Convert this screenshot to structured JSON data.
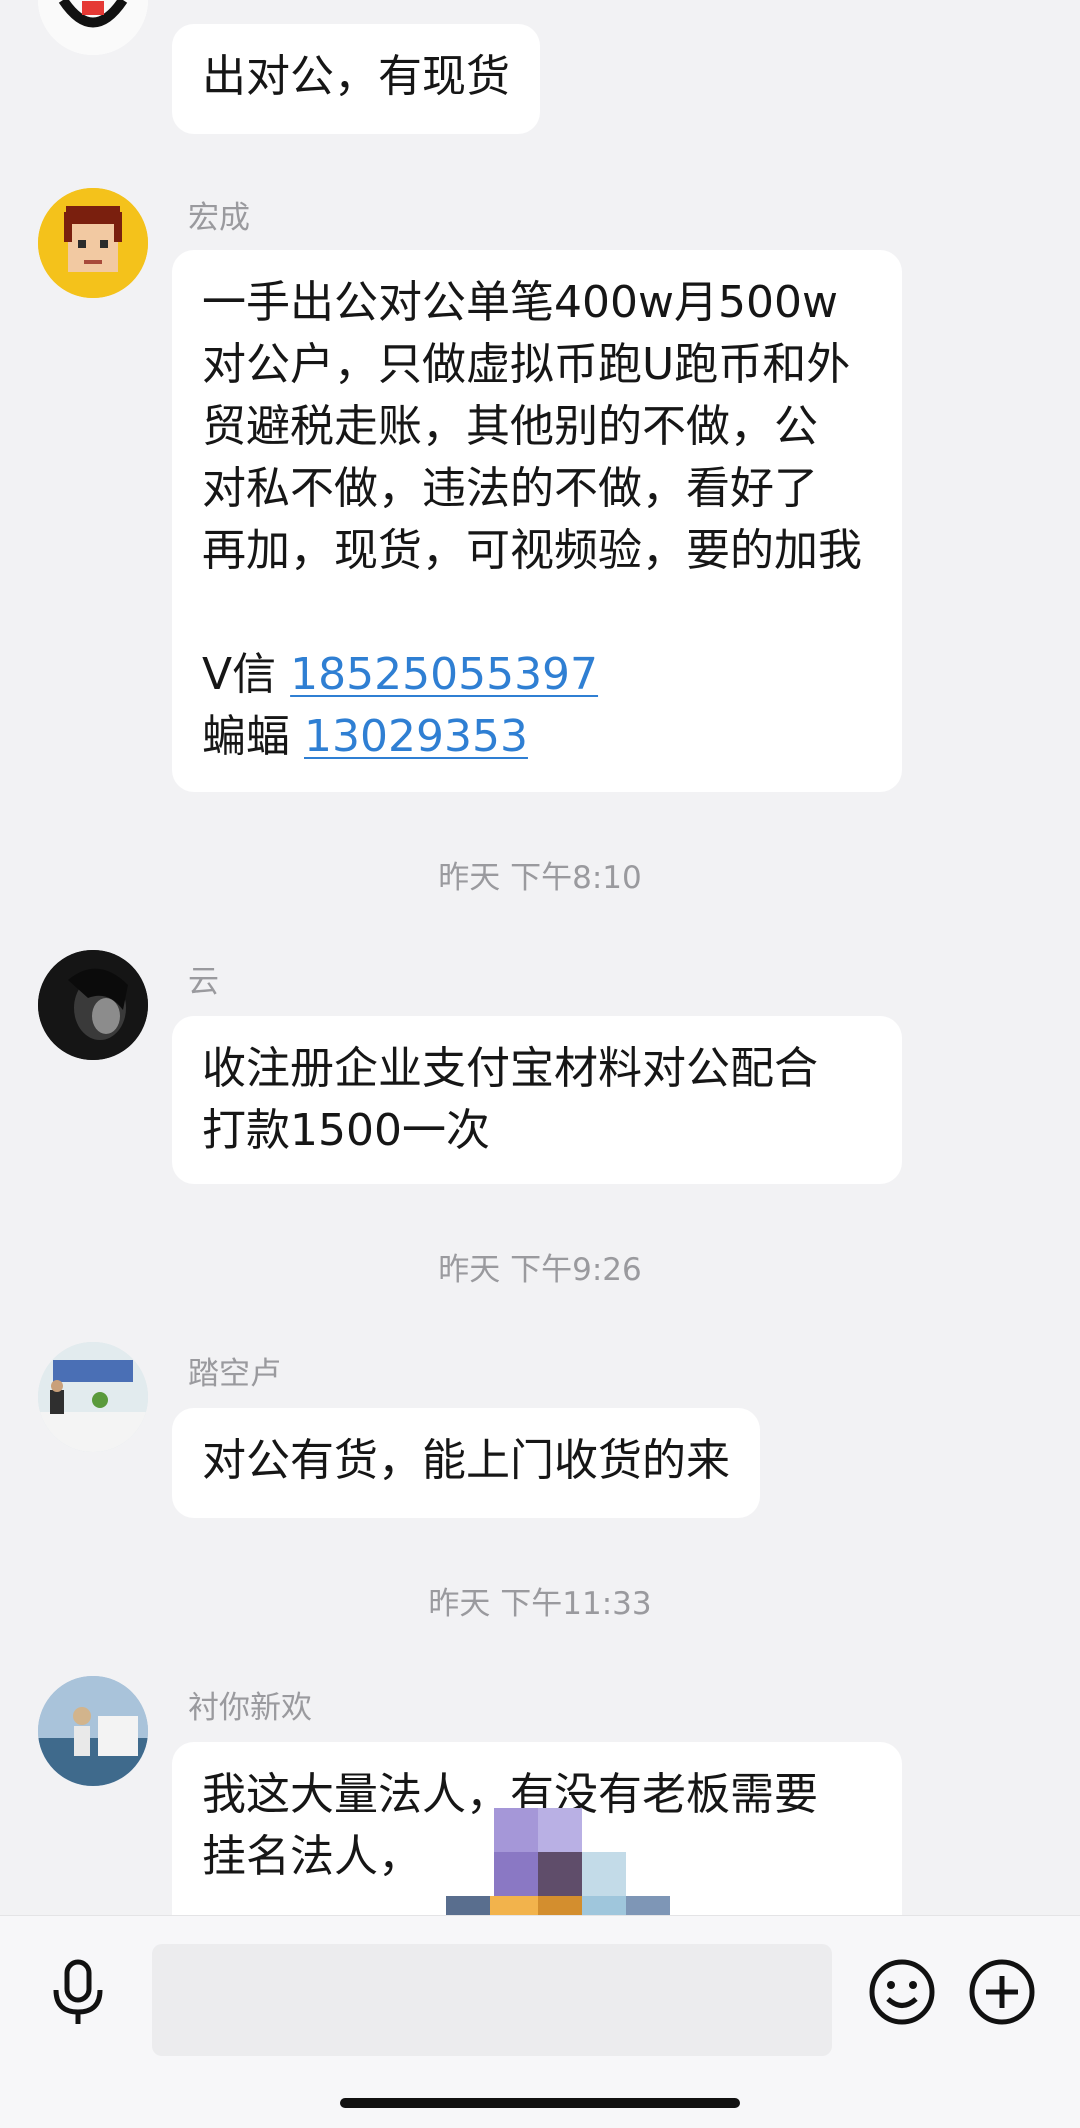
{
  "messages": [
    {
      "sender": "",
      "lines": [
        "出对公，有现货"
      ]
    },
    {
      "sender": "宏成",
      "lines": [
        "一手出公对公单笔400w月500w",
        "对公户，只做虚拟币跑U跑币和外",
        "贸避税走账，其他别的不做，公",
        "对私不做，违法的不做，看好了",
        "再加，现货，可视频验，要的加我"
      ],
      "contacts": [
        {
          "label": "V信",
          "number": "18525055397"
        },
        {
          "label": "蝙蝠",
          "number": "13029353"
        }
      ]
    },
    {
      "time": "昨天 下午8:10",
      "sender": "云",
      "lines": [
        "收注册企业支付宝材料对公配合",
        "打款1500一次"
      ]
    },
    {
      "time": "昨天 下午9:26",
      "sender": "踏空卢",
      "lines": [
        "对公有货，能上门收货的来"
      ]
    },
    {
      "time": "昨天 下午11:33",
      "sender": "衬你新欢",
      "lines": [
        "我这大量法人，有没有老板需要",
        "挂名法人，"
      ]
    }
  ],
  "colors": {
    "background": "#f2f2f4",
    "bubble": "#ffffff",
    "link": "#2f7fd3",
    "meta_text": "#9a9a9e"
  },
  "icons": {
    "voice": "microphone-icon",
    "emoji": "smiley-icon",
    "more": "plus-circle-icon"
  }
}
